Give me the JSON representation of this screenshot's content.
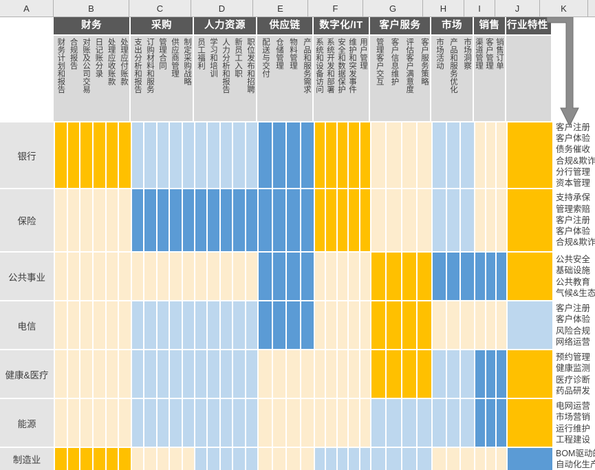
{
  "spreadsheet": {
    "column_letters": [
      "A",
      "B",
      "C",
      "D",
      "E",
      "F",
      "G",
      "H",
      "I",
      "J",
      "K"
    ],
    "corner_cell": ""
  },
  "colors": {
    "gold": "#FFC000",
    "cream": "#FDECCD",
    "light_blue": "#BDD7EE",
    "medium_blue": "#5B9BD5",
    "header_dark": "#595959",
    "subheader_gray": "#D9D9D9",
    "rowlabel_gray": "#E4E4E4",
    "arrow_gray": "#7F7F7F"
  },
  "column_groups": [
    {
      "letter": "B",
      "title": "财务",
      "subs": [
        "财务计划和报告",
        "合规报告",
        "对账及公司交易",
        "日记账分录",
        "处理应收账款",
        "处理应付账款"
      ]
    },
    {
      "letter": "C",
      "title": "采购",
      "subs": [
        "支出分析和报告",
        "订购材料和服务",
        "管理合同",
        "供应商管理",
        "制定采购战略"
      ]
    },
    {
      "letter": "D",
      "title": "人力资源",
      "subs": [
        "员工福利",
        "学习和培训",
        "人力分析和报告",
        "新员工入职",
        "职位发布和招聘"
      ]
    },
    {
      "letter": "E",
      "title": "供应链",
      "subs": [
        "配送与交付",
        "仓储管理",
        "物料管理",
        "产品和服务需求"
      ]
    },
    {
      "letter": "F",
      "title": "数字化/IT",
      "subs": [
        "系统和设备访问",
        "系统开发和部署",
        "安全和数据保护",
        "维护和突发事件",
        "用户管理"
      ]
    },
    {
      "letter": "G",
      "title": "客户服务",
      "subs": [
        "管理客户交互",
        "客户信息维护",
        "评估客户满意度",
        "客户服务策略"
      ]
    },
    {
      "letter": "H",
      "title": "市场",
      "subs": [
        "市场活动",
        "产品和服务优化",
        "市场洞察"
      ]
    },
    {
      "letter": "I",
      "title": "销售",
      "subs": [
        "渠道管理",
        "客户管理",
        "销售订单"
      ]
    },
    {
      "letter": "J",
      "title": "行业特性",
      "subs": [
        ""
      ]
    }
  ],
  "rows": [
    {
      "label": "银行",
      "cells": {
        "B": [
          "gold",
          "gold",
          "gold",
          "gold",
          "gold",
          "gold"
        ],
        "C": [
          "light_blue",
          "light_blue",
          "light_blue",
          "light_blue",
          "light_blue"
        ],
        "D": [
          "light_blue",
          "light_blue",
          "light_blue",
          "light_blue",
          "light_blue"
        ],
        "E": [
          "medium_blue",
          "medium_blue",
          "medium_blue",
          "medium_blue"
        ],
        "F": [
          "gold",
          "gold",
          "gold",
          "gold",
          "gold"
        ],
        "G": [
          "cream",
          "cream",
          "cream",
          "cream"
        ],
        "H": [
          "light_blue",
          "light_blue",
          "light_blue"
        ],
        "I": [
          "cream",
          "cream",
          "cream"
        ],
        "J": [
          "gold"
        ]
      },
      "details": [
        "客户注册",
        "客户体验",
        "债务催收",
        "合规&欺诈",
        "分行管理",
        "资本管理"
      ]
    },
    {
      "label": "保险",
      "cells": {
        "B": [
          "cream",
          "cream",
          "cream",
          "cream",
          "cream",
          "cream"
        ],
        "C": [
          "medium_blue",
          "medium_blue",
          "medium_blue",
          "medium_blue",
          "medium_blue"
        ],
        "D": [
          "medium_blue",
          "medium_blue",
          "medium_blue",
          "medium_blue",
          "medium_blue"
        ],
        "E": [
          "medium_blue",
          "medium_blue",
          "medium_blue",
          "medium_blue"
        ],
        "F": [
          "gold",
          "gold",
          "gold",
          "gold",
          "gold"
        ],
        "G": [
          "cream",
          "cream",
          "cream",
          "cream"
        ],
        "H": [
          "light_blue",
          "light_blue",
          "light_blue"
        ],
        "I": [
          "cream",
          "cream",
          "cream"
        ],
        "J": [
          "gold"
        ]
      },
      "details": [
        "支持承保",
        "管理索赔",
        "客户注册",
        "客户体验",
        "合规&欺诈"
      ]
    },
    {
      "label": "公共事业",
      "cells": {
        "B": [
          "cream",
          "cream",
          "cream",
          "cream",
          "cream",
          "cream"
        ],
        "C": [
          "cream",
          "cream",
          "cream",
          "cream",
          "cream"
        ],
        "D": [
          "cream",
          "cream",
          "cream",
          "cream",
          "cream"
        ],
        "E": [
          "medium_blue",
          "medium_blue",
          "medium_blue",
          "medium_blue"
        ],
        "F": [
          "cream",
          "cream",
          "cream",
          "cream",
          "cream"
        ],
        "G": [
          "gold",
          "gold",
          "gold",
          "gold"
        ],
        "H": [
          "medium_blue",
          "medium_blue",
          "medium_blue"
        ],
        "I": [
          "medium_blue",
          "medium_blue",
          "medium_blue"
        ],
        "J": [
          "gold"
        ]
      },
      "details": [
        "公共安全",
        "基础设施",
        "公共教育",
        "气候&生态"
      ]
    },
    {
      "label": "电信",
      "cells": {
        "B": [
          "cream",
          "cream",
          "cream",
          "cream",
          "cream",
          "cream"
        ],
        "C": [
          "light_blue",
          "light_blue",
          "light_blue",
          "light_blue",
          "light_blue"
        ],
        "D": [
          "light_blue",
          "light_blue",
          "light_blue",
          "light_blue",
          "light_blue"
        ],
        "E": [
          "medium_blue",
          "medium_blue",
          "medium_blue",
          "medium_blue"
        ],
        "F": [
          "cream",
          "cream",
          "cream",
          "cream",
          "cream"
        ],
        "G": [
          "gold",
          "gold",
          "gold",
          "gold"
        ],
        "H": [
          "cream",
          "cream",
          "cream"
        ],
        "I": [
          "cream",
          "cream",
          "cream"
        ],
        "J": [
          "light_blue"
        ]
      },
      "details": [
        "客户注册",
        "客户体验",
        "风险合规",
        "网络运营"
      ]
    },
    {
      "label": "健康&医疗",
      "cells": {
        "B": [
          "cream",
          "cream",
          "cream",
          "cream",
          "cream",
          "cream"
        ],
        "C": [
          "light_blue",
          "light_blue",
          "light_blue",
          "light_blue",
          "light_blue"
        ],
        "D": [
          "light_blue",
          "light_blue",
          "light_blue",
          "light_blue",
          "light_blue"
        ],
        "E": [
          "cream",
          "cream",
          "cream",
          "cream"
        ],
        "F": [
          "cream",
          "cream",
          "cream",
          "cream",
          "cream"
        ],
        "G": [
          "gold",
          "gold",
          "gold",
          "gold"
        ],
        "H": [
          "light_blue",
          "light_blue",
          "light_blue"
        ],
        "I": [
          "medium_blue",
          "medium_blue",
          "medium_blue"
        ],
        "J": [
          "gold"
        ]
      },
      "details": [
        "预约管理",
        "健康监测",
        "医疗诊断",
        "药品研发"
      ]
    },
    {
      "label": "能源",
      "cells": {
        "B": [
          "cream",
          "cream",
          "cream",
          "cream",
          "cream",
          "cream"
        ],
        "C": [
          "light_blue",
          "light_blue",
          "light_blue",
          "light_blue",
          "light_blue"
        ],
        "D": [
          "light_blue",
          "light_blue",
          "light_blue",
          "light_blue",
          "light_blue"
        ],
        "E": [
          "cream",
          "cream",
          "cream",
          "cream"
        ],
        "F": [
          "cream",
          "cream",
          "cream",
          "cream",
          "cream"
        ],
        "G": [
          "light_blue",
          "light_blue",
          "light_blue",
          "light_blue"
        ],
        "H": [
          "light_blue",
          "light_blue",
          "light_blue"
        ],
        "I": [
          "medium_blue",
          "medium_blue",
          "medium_blue"
        ],
        "J": [
          "gold"
        ]
      },
      "details": [
        "电网运营",
        "市场营销",
        "运行维护",
        "工程建设"
      ]
    },
    {
      "label": "制造业",
      "cells": {
        "B": [
          "gold",
          "gold",
          "gold",
          "gold",
          "gold",
          "gold"
        ],
        "C": [
          "cream",
          "cream",
          "cream",
          "cream",
          "cream"
        ],
        "D": [
          "light_blue",
          "light_blue",
          "light_blue",
          "light_blue",
          "light_blue"
        ],
        "E": [
          "cream",
          "cream",
          "cream",
          "cream"
        ],
        "F": [
          "light_blue",
          "light_blue",
          "light_blue",
          "light_blue",
          "light_blue"
        ],
        "G": [
          "light_blue",
          "light_blue",
          "light_blue",
          "light_blue"
        ],
        "H": [
          "cream",
          "cream",
          "cream"
        ],
        "I": [
          "cream",
          "cream",
          "cream"
        ],
        "J": [
          "medium_blue"
        ]
      },
      "details": [
        "BOM驱动的",
        "自动化生产"
      ]
    }
  ],
  "annotation": {
    "arrow_name": "elbow-arrow-pointing-down-to-details"
  }
}
